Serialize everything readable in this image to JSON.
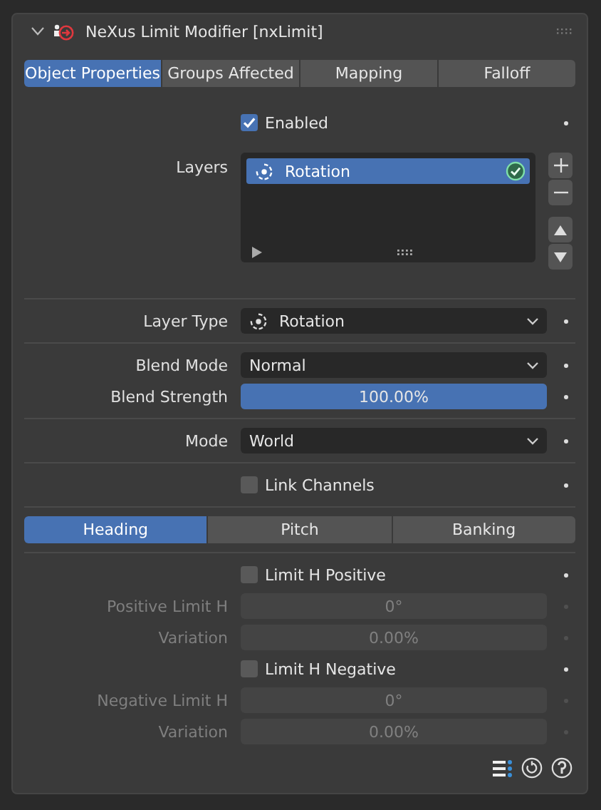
{
  "panel": {
    "title": "NeXus Limit Modifier [nxLimit]",
    "expanded": true
  },
  "tabs": [
    {
      "label": "Object Properties",
      "selected": true
    },
    {
      "label": "Groups Affected",
      "selected": false
    },
    {
      "label": "Mapping",
      "selected": false
    },
    {
      "label": "Falloff",
      "selected": false
    }
  ],
  "sections": [
    {
      "rows": [
        {
          "kind": "checkbox",
          "label": "Enabled",
          "checked": true
        },
        {
          "kind": "layers",
          "label": "Layers",
          "items": [
            {
              "label": "Rotation",
              "selected": true,
              "on": true
            }
          ]
        }
      ]
    },
    {
      "rows": [
        {
          "kind": "layer_type",
          "label": "Layer Type",
          "value": "Rotation"
        }
      ]
    },
    {
      "rows": [
        {
          "kind": "dropdown",
          "label": "Blend Mode",
          "value": "Normal"
        },
        {
          "kind": "slider",
          "label": "Blend Strength",
          "level": 1.0,
          "reading": "100.00%"
        }
      ]
    },
    {
      "rows": [
        {
          "kind": "dropdown",
          "label": "Mode",
          "value": "World"
        }
      ]
    },
    {
      "rows": [
        {
          "kind": "checkbox",
          "label": "Link Channels",
          "checked": false
        }
      ]
    }
  ],
  "channel_tabs": [
    {
      "label": "Heading",
      "selected": true
    },
    {
      "label": "Pitch",
      "selected": false
    },
    {
      "label": "Banking",
      "selected": false
    }
  ],
  "limits": [
    {
      "kind": "checkbox",
      "label": "Limit H Positive",
      "checked": false
    },
    {
      "kind": "field",
      "label": "Positive Limit H",
      "value": "0°",
      "disabled": true
    },
    {
      "kind": "field",
      "label": "Variation",
      "value": "0.00%",
      "disabled": true
    },
    {
      "kind": "checkbox",
      "label": "Limit H Negative",
      "checked": false
    },
    {
      "kind": "field",
      "label": "Negative Limit H",
      "value": "0°",
      "disabled": true
    },
    {
      "kind": "field",
      "label": "Variation",
      "value": "0.00%",
      "disabled": true
    }
  ]
}
